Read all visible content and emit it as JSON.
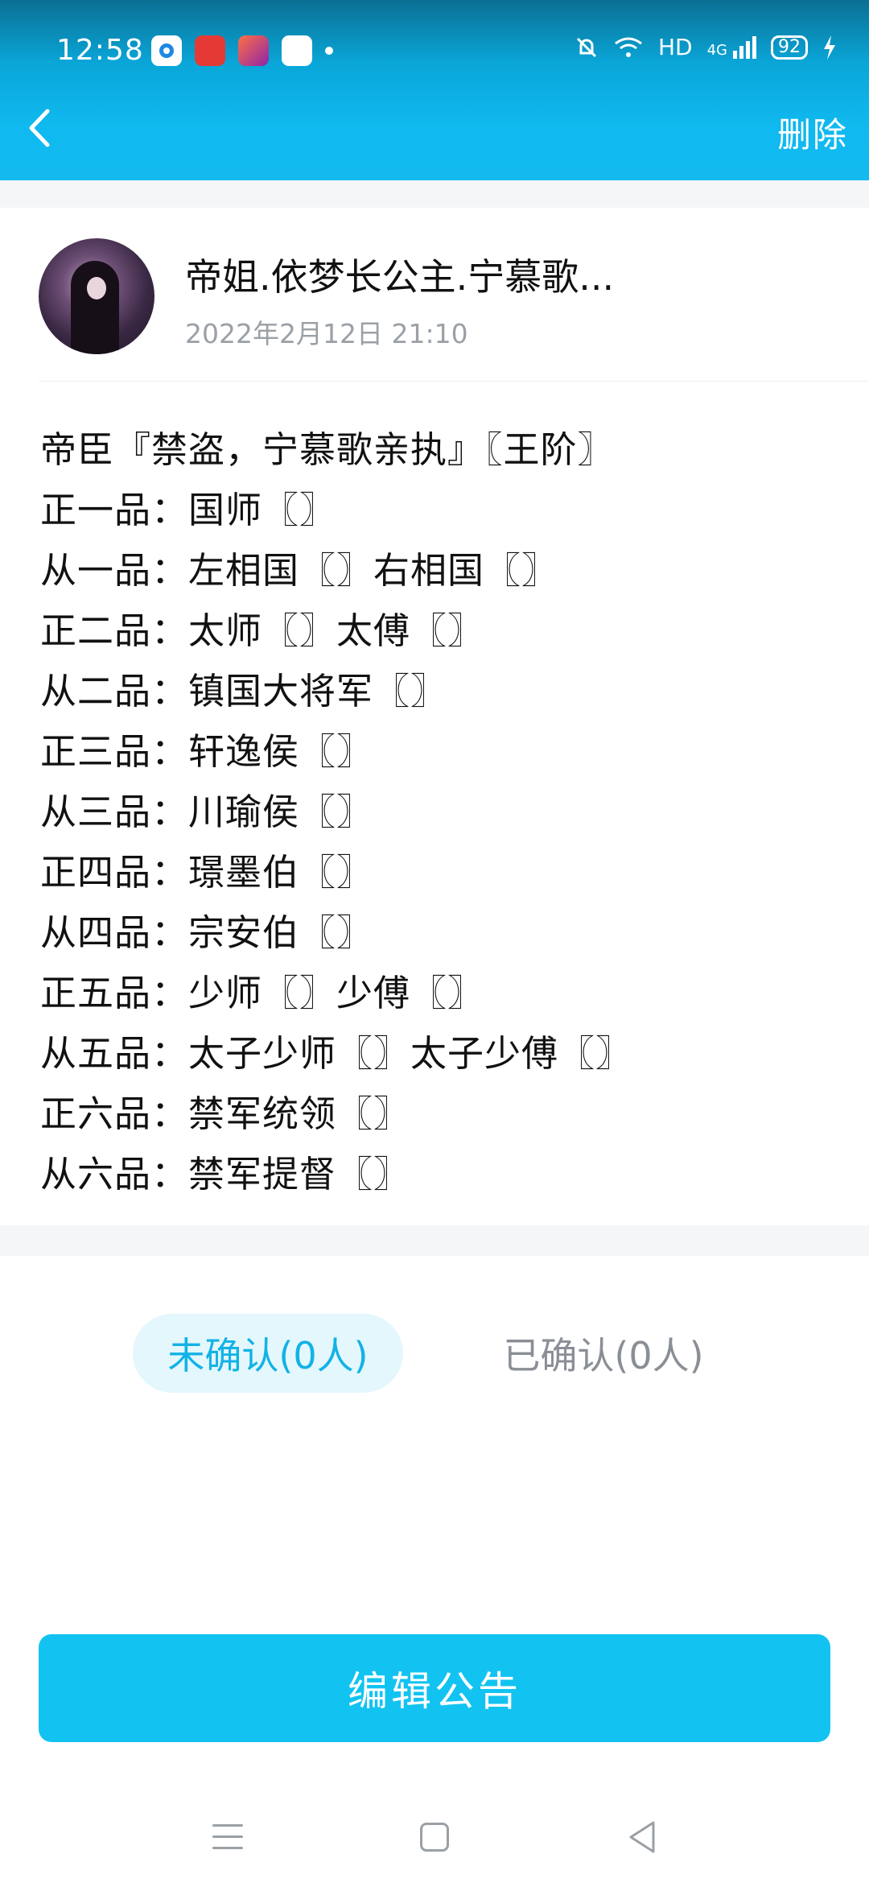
{
  "status_bar": {
    "time": "12:58",
    "network": "HD",
    "signal_label": "4G",
    "battery": "92"
  },
  "app_bar": {
    "back_icon": "chevron-left-icon",
    "delete_label": "删除"
  },
  "post": {
    "author": "帝姐.依梦长公主.宁慕歌...",
    "timestamp": "2022年2月12日 21:10",
    "lines": [
      "帝臣『禁盗，宁慕歌亲执』〖王阶〗",
      "正一品：国师〖〗",
      "从一品：左相国〖〗右相国〖〗",
      "正二品：太师〖〗太傅〖〗",
      "从二品：镇国大将军〖〗",
      "正三品：轩逸侯〖〗",
      "从三品：川瑜侯〖〗",
      "正四品：璟墨伯〖〗",
      "从四品：宗安伯〖〗",
      "正五品：少师〖〗少傅〖〗",
      "从五品：太子少师〖〗太子少傅〖〗",
      "正六品：禁军统领〖〗",
      "从六品：禁军提督〖〗"
    ]
  },
  "confirm_tabs": {
    "unconfirmed": "未确认(0人)",
    "confirmed": "已确认(0人)",
    "active": "unconfirmed"
  },
  "actions": {
    "edit_label": "编辑公告"
  },
  "colors": {
    "accent": "#12c3f2",
    "tab_active_bg": "#e3f7fc",
    "tab_active_text": "#12b2e6"
  }
}
